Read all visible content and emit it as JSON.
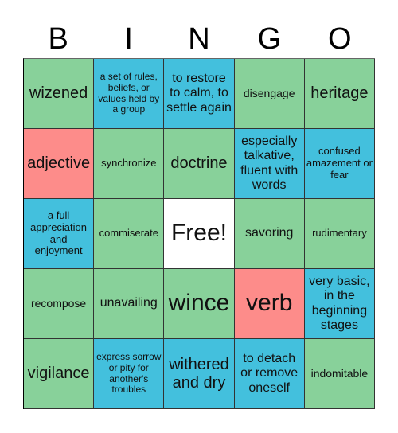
{
  "header": [
    "B",
    "I",
    "N",
    "G",
    "O"
  ],
  "colors": {
    "green": "#88d19a",
    "blue": "#43c0dd",
    "red": "#fd8c8a",
    "white": "#ffffff"
  },
  "cells": [
    {
      "text": "wizened",
      "color": "green",
      "size": "lg"
    },
    {
      "text": "a set of rules, beliefs, or values held by a group",
      "color": "blue",
      "size": "xxs"
    },
    {
      "text": "to restore to calm, to settle again",
      "color": "blue",
      "size": "md"
    },
    {
      "text": "disengage",
      "color": "green",
      "size": "sm"
    },
    {
      "text": "heritage",
      "color": "green",
      "size": "lg"
    },
    {
      "text": "adjective",
      "color": "red",
      "size": "lg"
    },
    {
      "text": "synchronize",
      "color": "green",
      "size": "xs"
    },
    {
      "text": "doctrine",
      "color": "green",
      "size": "lg"
    },
    {
      "text": "especially talkative, fluent with words",
      "color": "blue",
      "size": "md"
    },
    {
      "text": "confused amazement or fear",
      "color": "blue",
      "size": "xs"
    },
    {
      "text": "a full appreciation and enjoyment",
      "color": "blue",
      "size": "xs"
    },
    {
      "text": "commiserate",
      "color": "green",
      "size": "xs"
    },
    {
      "text": "Free!",
      "color": "white",
      "size": "xl"
    },
    {
      "text": "savoring",
      "color": "green",
      "size": "md"
    },
    {
      "text": "rudimentary",
      "color": "green",
      "size": "xs"
    },
    {
      "text": "recompose",
      "color": "green",
      "size": "sm"
    },
    {
      "text": "unavailing",
      "color": "green",
      "size": "md"
    },
    {
      "text": "wince",
      "color": "green",
      "size": "xl"
    },
    {
      "text": "verb",
      "color": "red",
      "size": "xl"
    },
    {
      "text": "very basic, in the beginning stages",
      "color": "blue",
      "size": "md"
    },
    {
      "text": "vigilance",
      "color": "green",
      "size": "lg"
    },
    {
      "text": "express sorrow or pity for another's troubles",
      "color": "blue",
      "size": "xxs"
    },
    {
      "text": "withered and dry",
      "color": "blue",
      "size": "lg"
    },
    {
      "text": "to detach or remove oneself",
      "color": "blue",
      "size": "md"
    },
    {
      "text": "indomitable",
      "color": "green",
      "size": "sm"
    }
  ]
}
